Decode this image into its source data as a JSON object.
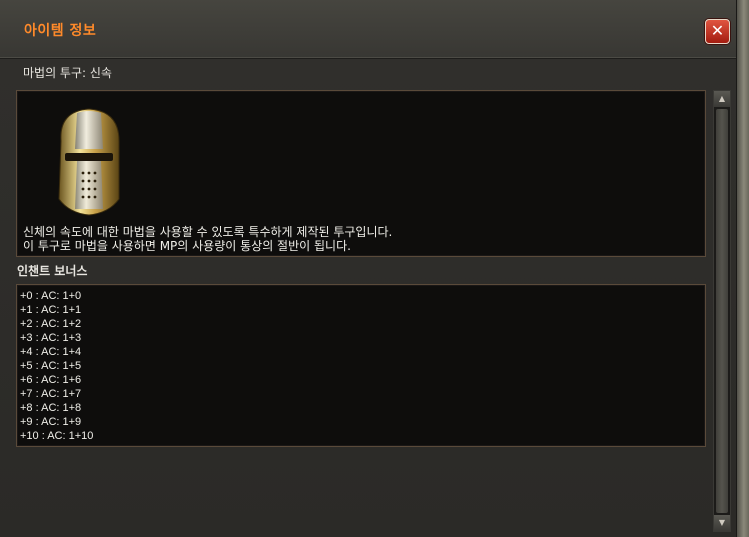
{
  "window": {
    "title": "아이템 정보",
    "close_label": "✕"
  },
  "item": {
    "name": "마법의 투구: 신속",
    "icon": "knight-helmet-icon",
    "description": [
      "신체의 속도에 대한 마법을 사용할 수 있도록 특수하게 제작된 투구입니다.",
      "이 투구로 마법을 사용하면 MP의 사용량이 통상의 절반이 됩니다."
    ]
  },
  "enchant": {
    "label": "인챈트 보너스",
    "rows": [
      "+0 : AC: 1+0",
      "+1 : AC: 1+1",
      "+2 : AC: 1+2",
      "+3 : AC: 1+3",
      "+4 : AC: 1+4",
      "+5 : AC: 1+5",
      "+6 : AC: 1+6",
      "+7 : AC: 1+7",
      "+8 : AC: 1+8",
      "+9 : AC: 1+9",
      "+10 : AC: 1+10"
    ]
  },
  "scrollbar": {
    "up": "▲",
    "down": "▼"
  },
  "colors": {
    "title": "#ff8a2a",
    "close": "#c0301e",
    "panel": "#0e0d0c",
    "panel_border": "#5a4a3a"
  }
}
